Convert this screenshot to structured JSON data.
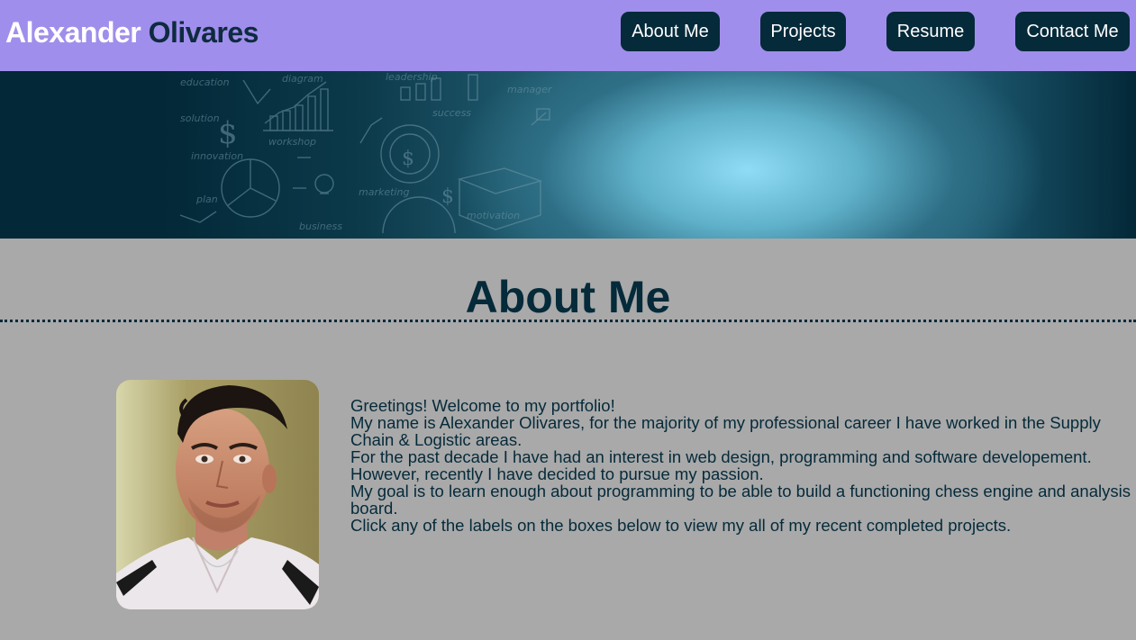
{
  "header": {
    "brand_first": "Alexander",
    "brand_last": "Olivares",
    "nav": [
      {
        "label": "About Me"
      },
      {
        "label": "Projects"
      },
      {
        "label": "Resume"
      },
      {
        "label": "Contact Me"
      }
    ]
  },
  "banner": {
    "doodle_words": [
      "education",
      "diagram",
      "leadership",
      "manager",
      "solution",
      "success",
      "workshop",
      "innovation",
      "plan",
      "marketing",
      "motivation",
      "business"
    ]
  },
  "about": {
    "title": "About Me",
    "paragraphs": [
      "Greetings! Welcome to my portfolio!",
      "My name is Alexander Olivares, for the majority of my professional career I have worked in the Supply Chain & Logistic areas.",
      "For the past decade I have had an interest in web design, programming and software developement. However, recently I have decided to pursue my passion.",
      "My goal is to learn enough about programming to be able to build a functioning chess engine and analysis board.",
      "Click any of the labels on the boxes below to view my all of my recent completed projects."
    ]
  },
  "colors": {
    "header_bg": "#a08eec",
    "nav_bg": "#052a3a",
    "page_bg": "#a9a9a9",
    "text_dark": "#052a3a"
  }
}
